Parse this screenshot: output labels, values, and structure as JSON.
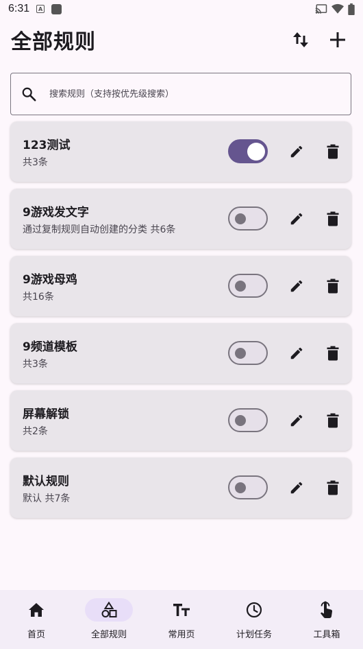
{
  "status_bar": {
    "time": "6:31",
    "icons": [
      "a-badge-icon",
      "square-app-icon",
      "cast-icon",
      "wifi-icon",
      "battery-icon"
    ]
  },
  "header": {
    "title": "全部规则",
    "sort_icon": "swap-vertical-icon",
    "add_icon": "plus-icon"
  },
  "search": {
    "placeholder": "搜索规则（支持按优先级搜索）",
    "value": ""
  },
  "rules": [
    {
      "title": "123测试",
      "desc": "共3条",
      "enabled": true
    },
    {
      "title": "9游戏发文字",
      "desc": "通过复制规则自动创建的分类 共6条",
      "enabled": false
    },
    {
      "title": "9游戏母鸡",
      "desc": "共16条",
      "enabled": false
    },
    {
      "title": "9频道模板",
      "desc": "共3条",
      "enabled": false
    },
    {
      "title": "屏幕解锁",
      "desc": "共2条",
      "enabled": false
    },
    {
      "title": "默认规则",
      "desc": "默认 共7条",
      "enabled": false
    }
  ],
  "bottom_nav": [
    {
      "label": "首页",
      "icon": "home-icon",
      "active": false
    },
    {
      "label": "全部规则",
      "icon": "shapes-icon",
      "active": true
    },
    {
      "label": "常用页",
      "icon": "text-size-icon",
      "active": false
    },
    {
      "label": "计划任务",
      "icon": "clock-icon",
      "active": false
    },
    {
      "label": "工具箱",
      "icon": "touch-icon",
      "active": false
    }
  ],
  "colors": {
    "background": "#fdf7fc",
    "card": "#e9e5ea",
    "accent": "#65558f",
    "nav_active_pill": "#e8def8"
  }
}
